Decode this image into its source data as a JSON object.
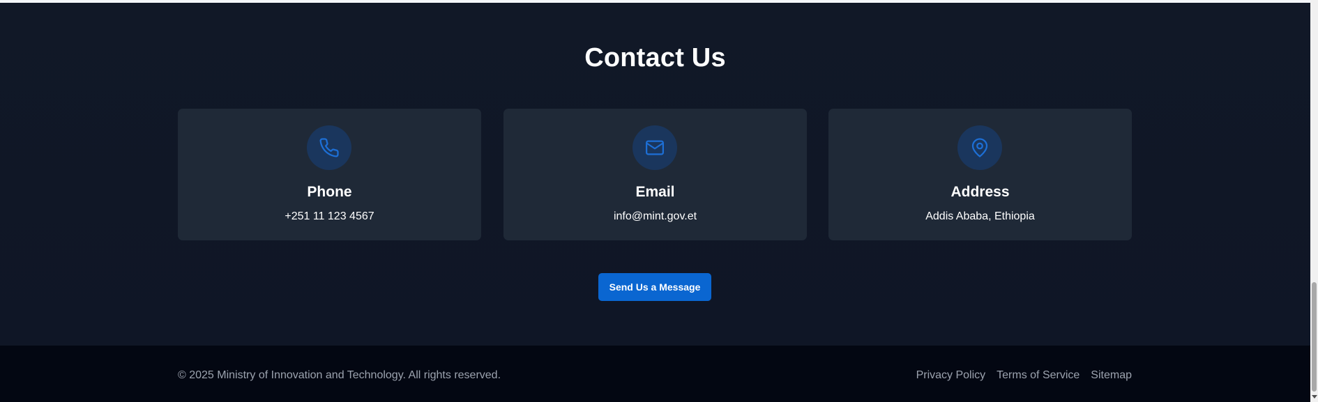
{
  "contact": {
    "title": "Contact Us",
    "cards": [
      {
        "icon": "phone-icon",
        "title": "Phone",
        "value": "+251 11 123 4567"
      },
      {
        "icon": "mail-icon",
        "title": "Email",
        "value": "info@mint.gov.et"
      },
      {
        "icon": "map-pin-icon",
        "title": "Address",
        "value": "Addis Ababa, Ethiopia"
      }
    ],
    "button_label": "Send Us a Message"
  },
  "footer": {
    "copyright": "© 2025 Ministry of Innovation and Technology. All rights reserved.",
    "links": [
      "Privacy Policy",
      "Terms of Service",
      "Sitemap"
    ]
  },
  "colors": {
    "section_bg": "#111827",
    "card_bg": "#1f2937",
    "accent": "#0a66d1",
    "icon_circle_bg": "#1a365d",
    "footer_bg": "#030712",
    "muted_text": "#9ca3af"
  }
}
